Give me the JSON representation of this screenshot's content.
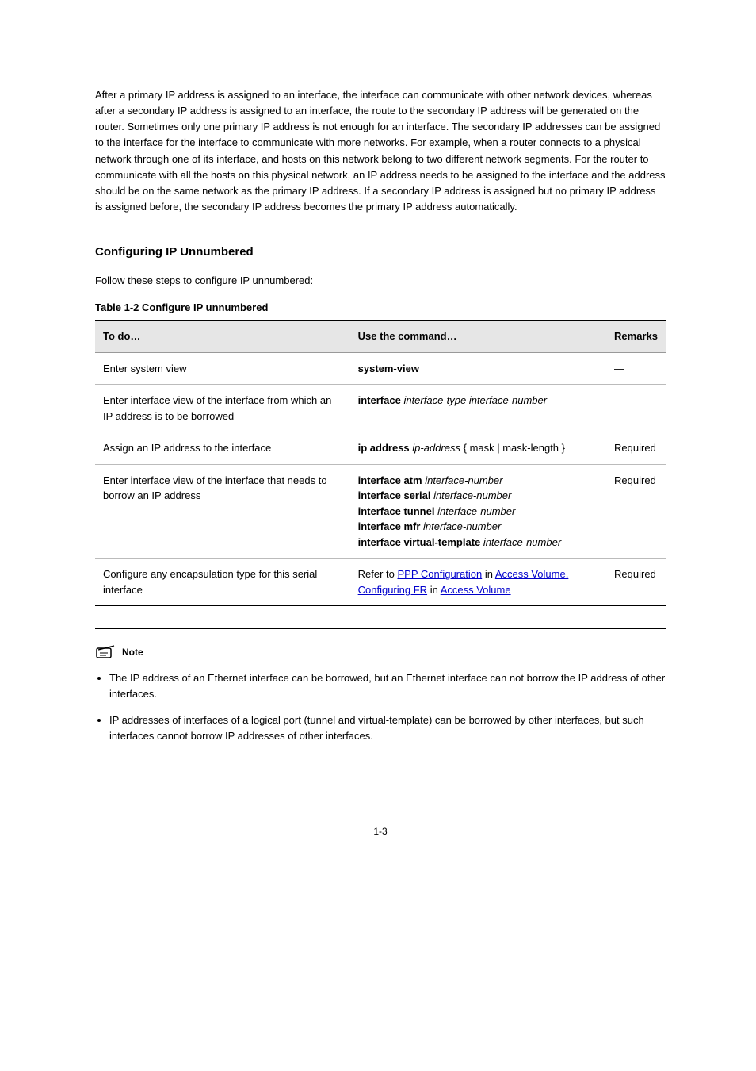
{
  "intro_paragraph": "After a primary IP address is assigned to an interface, the interface can communicate with other network devices, whereas after a secondary IP address is assigned to an interface, the route to the secondary IP address will be generated on the router. Sometimes only one primary IP address is not enough for an interface. The secondary IP addresses can be assigned to the interface for the interface to communicate with more networks. For example, when a router connects to a physical network through one of its interface, and hosts on this network belong to two different network segments. For the router to communicate with all the hosts on this physical network, an IP address needs to be assigned to the interface and the address should be on the same network as the primary IP address. If a secondary IP address is assigned but no primary IP address is assigned before, the secondary IP address becomes the primary IP address automatically.",
  "section_title": "Configuring IP Unnumbered",
  "lead_paragraph": "Follow these steps to configure IP unnumbered:",
  "table_caption": "Table 1-2 Configure IP unnumbered",
  "table_headers": {
    "c0": "To do…",
    "c1": "Use the command…",
    "c2": "Remarks"
  },
  "rows": [
    {
      "todo": "Enter system view",
      "cmd_bold": "system-view",
      "cmd_plain": "",
      "remarks": "—"
    },
    {
      "todo": "Enter interface view of the interface from which an IP address is to be borrowed",
      "cmd_bold": "interface",
      "cmd_italic": "interface-type interface-number",
      "remarks": "—"
    },
    {
      "todo": "Assign an IP address to the interface",
      "cmd_bold": "ip address",
      "cmd_italic": "ip-address",
      "cmd_rest": " { mask | mask-length }",
      "remarks": "Required"
    },
    {
      "todo": "Enter interface view of the interface that needs to borrow an IP address",
      "ifaces_prefix": "interface",
      "iface_list": [
        {
          "bold": "atm",
          "italic": "interface-number"
        },
        {
          "bold": "serial",
          "italic": "interface-number"
        },
        {
          "bold": "tunnel",
          "italic": "interface-number"
        },
        {
          "bold": "mfr",
          "italic": "interface-number"
        },
        {
          "bold": "virtual-template",
          "italic": "interface-number"
        }
      ],
      "remarks": "Required"
    }
  ],
  "row_last": {
    "todo": "Configure any encapsulation type for this serial interface",
    "link_prefix": "Refer to ",
    "link1_text": "PPP Configuration",
    "link_mid": " in ",
    "link2a_text": "Access Volume, Configuring FR",
    "link_mid2": " in ",
    "link2b_text": "Access Volume",
    "remarks": "Required"
  },
  "note_label": "Note",
  "note_bullets": [
    "The IP address of an Ethernet interface can be borrowed, but an Ethernet interface can not borrow the IP address of other interfaces.",
    "IP addresses of interfaces of a logical port (tunnel and virtual-template) can be borrowed by other interfaces, but such interfaces cannot borrow IP addresses of other interfaces."
  ],
  "page_number": "1-3"
}
